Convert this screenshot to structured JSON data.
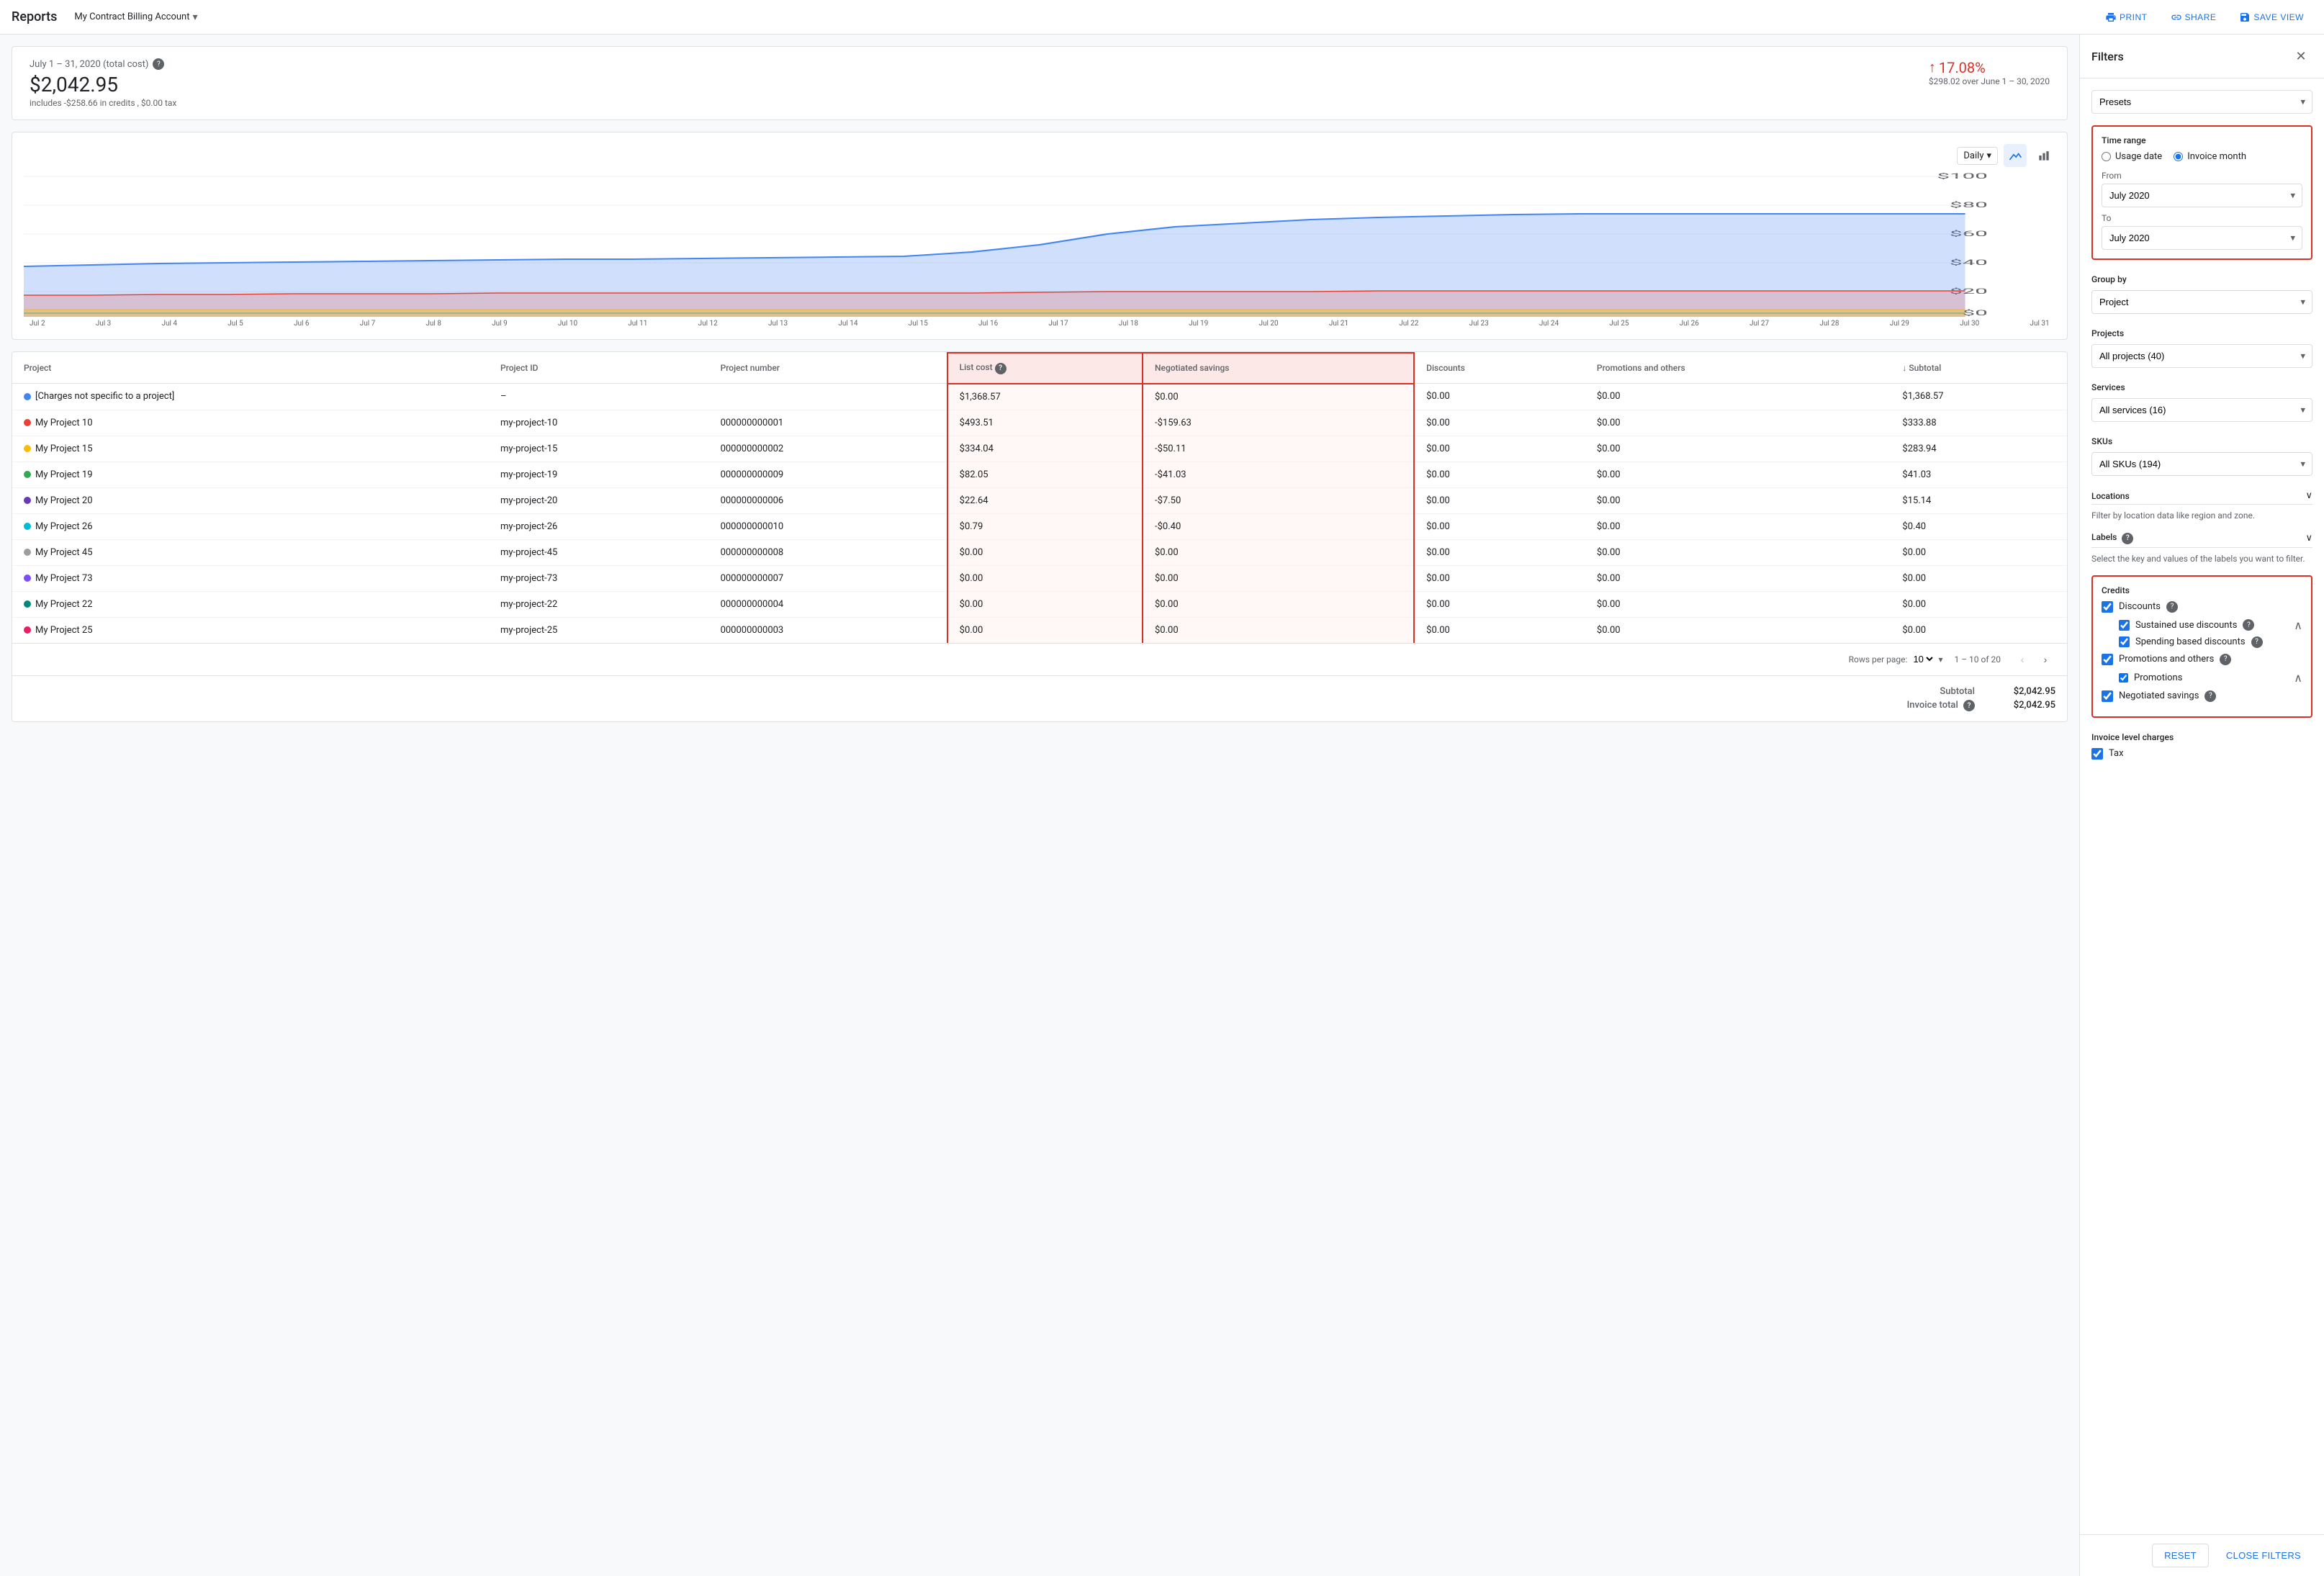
{
  "header": {
    "title": "Reports",
    "account": "My Contract Billing Account",
    "actions": {
      "print": "PRINT",
      "share": "SHARE",
      "save_view": "SAVE VIEW"
    }
  },
  "summary": {
    "date_range": "July 1 – 31, 2020 (total cost)",
    "total_cost": "$2,042.95",
    "includes": "includes -$258.66 in credits , $0.00 tax",
    "change_pct": "17.08%",
    "change_amount": "$298.02 over June 1 – 30, 2020"
  },
  "chart": {
    "granularity": "Daily",
    "x_labels": [
      "Jul 2",
      "Jul 3",
      "Jul 4",
      "Jul 5",
      "Jul 6",
      "Jul 7",
      "Jul 8",
      "Jul 9",
      "Jul 10",
      "Jul 11",
      "Jul 12",
      "Jul 13",
      "Jul 14",
      "Jul 15",
      "Jul 16",
      "Jul 17",
      "Jul 18",
      "Jul 19",
      "Jul 20",
      "Jul 21",
      "Jul 22",
      "Jul 23",
      "Jul 24",
      "Jul 25",
      "Jul 26",
      "Jul 27",
      "Jul 28",
      "Jul 29",
      "Jul 30",
      "Jul 31"
    ],
    "y_labels": [
      "$100",
      "$80",
      "$60",
      "$40",
      "$20",
      "$0"
    ]
  },
  "table": {
    "columns": [
      "Project",
      "Project ID",
      "Project number",
      "List cost",
      "Negotiated savings",
      "Discounts",
      "Promotions and others",
      "Subtotal"
    ],
    "rows": [
      {
        "project": "[Charges not specific to a project]",
        "project_id": "–",
        "project_number": "",
        "list_cost": "$1,368.57",
        "negotiated_savings": "$0.00",
        "discounts": "$0.00",
        "promotions": "$0.00",
        "subtotal": "$1,368.57",
        "color": "#4285f4"
      },
      {
        "project": "My Project 10",
        "project_id": "my-project-10",
        "project_number": "000000000001",
        "list_cost": "$493.51",
        "negotiated_savings": "-$159.63",
        "discounts": "$0.00",
        "promotions": "$0.00",
        "subtotal": "$333.88",
        "color": "#ea4335"
      },
      {
        "project": "My Project 15",
        "project_id": "my-project-15",
        "project_number": "000000000002",
        "list_cost": "$334.04",
        "negotiated_savings": "-$50.11",
        "discounts": "$0.00",
        "promotions": "$0.00",
        "subtotal": "$283.94",
        "color": "#fbbc04"
      },
      {
        "project": "My Project 19",
        "project_id": "my-project-19",
        "project_number": "000000000009",
        "list_cost": "$82.05",
        "negotiated_savings": "-$41.03",
        "discounts": "$0.00",
        "promotions": "$0.00",
        "subtotal": "$41.03",
        "color": "#34a853"
      },
      {
        "project": "My Project 20",
        "project_id": "my-project-20",
        "project_number": "000000000006",
        "list_cost": "$22.64",
        "negotiated_savings": "-$7.50",
        "discounts": "$0.00",
        "promotions": "$0.00",
        "subtotal": "$15.14",
        "color": "#673ab7"
      },
      {
        "project": "My Project 26",
        "project_id": "my-project-26",
        "project_number": "000000000010",
        "list_cost": "$0.79",
        "negotiated_savings": "-$0.40",
        "discounts": "$0.00",
        "promotions": "$0.00",
        "subtotal": "$0.40",
        "color": "#00bcd4"
      },
      {
        "project": "My Project 45",
        "project_id": "my-project-45",
        "project_number": "000000000008",
        "list_cost": "$0.00",
        "negotiated_savings": "$0.00",
        "discounts": "$0.00",
        "promotions": "$0.00",
        "subtotal": "$0.00",
        "color": "#9e9e9e"
      },
      {
        "project": "My Project 73",
        "project_id": "my-project-73",
        "project_number": "000000000007",
        "list_cost": "$0.00",
        "negotiated_savings": "$0.00",
        "discounts": "$0.00",
        "promotions": "$0.00",
        "subtotal": "$0.00",
        "color": "#7c4dff"
      },
      {
        "project": "My Project 22",
        "project_id": "my-project-22",
        "project_number": "000000000004",
        "list_cost": "$0.00",
        "negotiated_savings": "$0.00",
        "discounts": "$0.00",
        "promotions": "$0.00",
        "subtotal": "$0.00",
        "color": "#00897b"
      },
      {
        "project": "My Project 25",
        "project_id": "my-project-25",
        "project_number": "000000000003",
        "list_cost": "$0.00",
        "negotiated_savings": "$0.00",
        "discounts": "$0.00",
        "promotions": "$0.00",
        "subtotal": "$0.00",
        "color": "#e91e63"
      }
    ],
    "pagination": {
      "rows_per_page": "10",
      "range": "1 – 10 of 20"
    },
    "totals": {
      "subtotal_label": "Subtotal",
      "subtotal_value": "$2,042.95",
      "invoice_total_label": "Invoice total",
      "invoice_total_value": "$2,042.95"
    }
  },
  "filters": {
    "title": "Filters",
    "presets_label": "Presets",
    "time_range": {
      "label": "Time range",
      "usage_date": "Usage date",
      "invoice_month": "Invoice month",
      "from_label": "From",
      "from_value": "July 2020",
      "to_label": "To",
      "to_value": "July 2020"
    },
    "group_by": {
      "label": "Group by",
      "value": "Project"
    },
    "projects": {
      "label": "Projects",
      "value": "All projects (40)"
    },
    "services": {
      "label": "Services",
      "value": "All services (16)"
    },
    "skus": {
      "label": "SKUs",
      "value": "All SKUs (194)"
    },
    "locations": {
      "label": "Locations",
      "description": "Filter by location data like region and zone."
    },
    "labels": {
      "label": "Labels",
      "description": "Select the key and values of the labels you want to filter."
    },
    "credits": {
      "label": "Credits",
      "discounts": {
        "label": "Discounts",
        "checked": true,
        "sustained_use": {
          "label": "Sustained use discounts",
          "checked": true
        },
        "spending_based": {
          "label": "Spending based discounts",
          "checked": true
        }
      },
      "promotions_and_others": {
        "label": "Promotions and others",
        "checked": true,
        "promotions": {
          "label": "Promotions",
          "checked": true
        }
      },
      "negotiated_savings": {
        "label": "Negotiated savings",
        "checked": true
      }
    },
    "invoice_level": {
      "label": "Invoice level charges",
      "tax": {
        "label": "Tax",
        "checked": true
      }
    },
    "reset_label": "RESET",
    "close_label": "CLOSE FILTERS"
  }
}
